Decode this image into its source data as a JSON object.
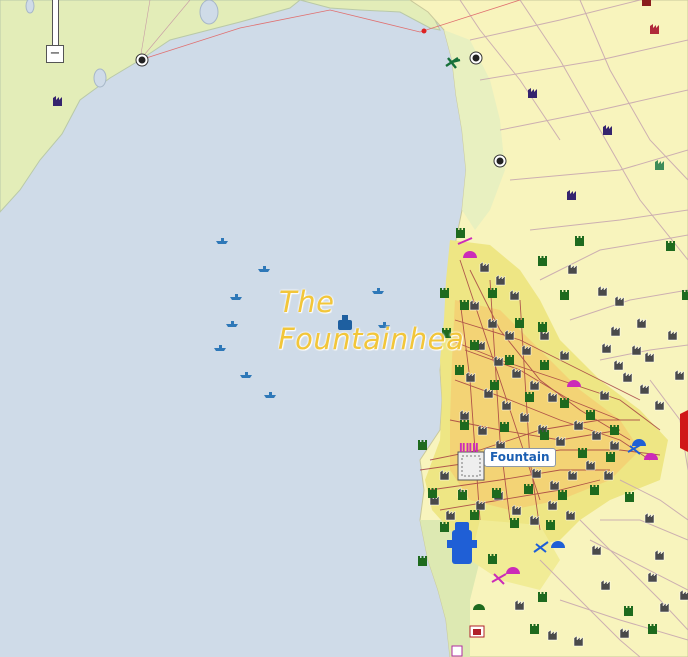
{
  "map": {
    "region_label_line1": "The",
    "region_label_line2": "Fountainhea",
    "city_label": "Fountain",
    "colors": {
      "water": "#cfdbe8",
      "land_light": "#f8f4bd",
      "land_green": "#e3edb8",
      "urban": "#eee684",
      "urban_core": "#f3cf72",
      "road": "#c8a8b0",
      "main_road": "#e07070",
      "region_label": "#f2c63a",
      "city_label_text": "#1b5fb3"
    },
    "icons": [
      "ship-icon",
      "factory-icon",
      "airport-icon",
      "antenna-icon",
      "park-icon",
      "radar-dome-icon",
      "military-jet-icon"
    ]
  },
  "zoom": {
    "zoom_out_label": "−"
  }
}
